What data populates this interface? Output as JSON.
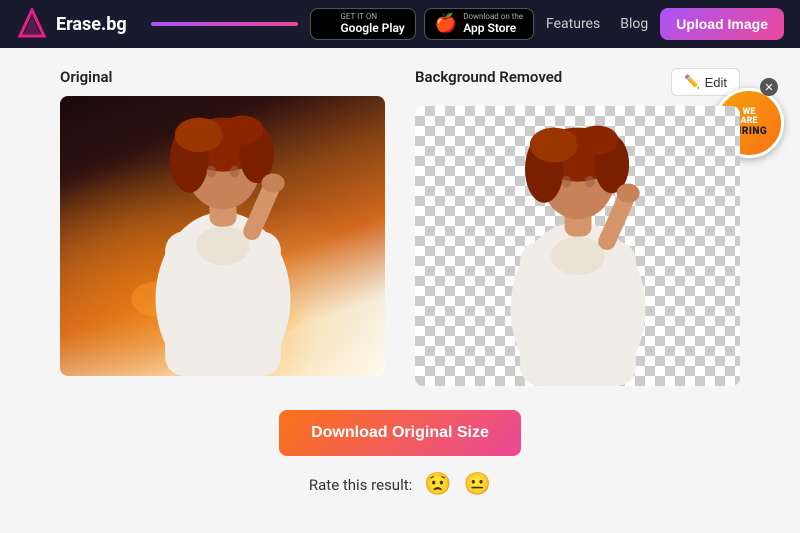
{
  "header": {
    "logo_text": "Erase.bg",
    "google_play_small": "GET IT ON",
    "google_play_name": "Google Play",
    "app_store_small": "Download on the",
    "app_store_name": "App Store",
    "nav_features": "Features",
    "nav_blog": "Blog",
    "upload_btn": "Upload Image"
  },
  "main": {
    "original_label": "Original",
    "bg_removed_label": "Background Removed",
    "edit_btn": "Edit",
    "download_btn": "Download Original Size",
    "rate_label": "Rate this result:",
    "rate_emoji_1": "😟",
    "rate_emoji_2": "😐",
    "hiring_we": "WE",
    "hiring_are": "ARE",
    "hiring_text": "HIRING",
    "close_badge": "✕"
  }
}
